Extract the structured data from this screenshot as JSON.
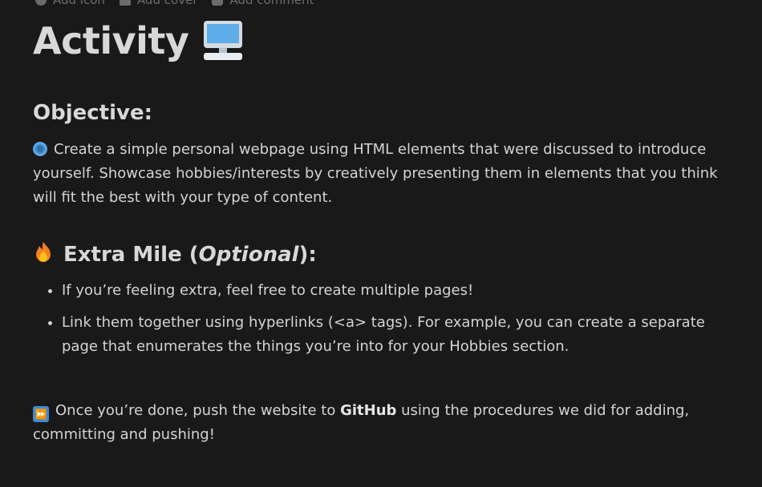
{
  "top_actions": [
    {
      "label": "Add icon",
      "icon": "smile-icon"
    },
    {
      "label": "Add cover",
      "icon": "image-icon"
    },
    {
      "label": "Add comment",
      "icon": "comment-icon"
    }
  ],
  "title": "Activity",
  "title_emoji": "desktop-computer-icon",
  "objective": {
    "heading": "Objective:",
    "icon": "globe-icon",
    "text": "Create a simple personal webpage using HTML elements that were discussed to introduce yourself. Showcase hobbies/interests by creatively presenting them in elements that you think will fit the best with your type of content."
  },
  "extra": {
    "icon": "fire-icon",
    "heading_pre": "Extra Mile (",
    "heading_em": "Optional",
    "heading_post": "):",
    "items": [
      "If you’re feeling extra, feel free to create multiple pages!",
      "Link them together using hyperlinks (<a> tags). For example, you can create a separate page that enumerates the things you’re into for your Hobbies section."
    ]
  },
  "final": {
    "icon": "fast-forward-icon",
    "pre": "Once you’re done, push the website to ",
    "bold": "GitHub",
    "post": " using the procedures we did for adding, committing and pushing!"
  }
}
